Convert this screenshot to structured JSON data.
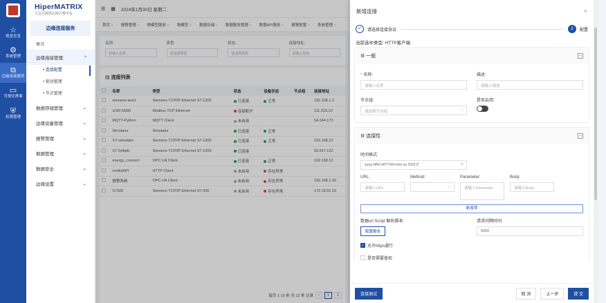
{
  "rail": {
    "items": [
      {
        "label": "视觉总览",
        "icon": "star-icon"
      },
      {
        "label": "系统管理",
        "icon": "gear-icon"
      },
      {
        "label": "边缘连接服务",
        "icon": "connect-icon"
      },
      {
        "label": "可视化界面",
        "icon": "screen-icon"
      },
      {
        "label": "权限管理",
        "icon": "shield-icon"
      }
    ]
  },
  "brand": {
    "name": "HiperMATRIX",
    "sub": "工业互联网边缘计算平台"
  },
  "sidebar": {
    "title": "边缘连接服务",
    "home": "概况",
    "groups": [
      {
        "label": "边缘连接管理",
        "open": true,
        "subs": [
          "连接配置",
          "驱动管理",
          "节点管理"
        ]
      },
      {
        "label": "数据存储管理"
      },
      {
        "label": "边缘设备管理"
      },
      {
        "label": "报警管理"
      },
      {
        "label": "数据管理"
      },
      {
        "label": "数据安全"
      },
      {
        "label": "边缘设置"
      }
    ]
  },
  "topbar": {
    "date": "2024年1月30日 星期二"
  },
  "tabs": [
    "首页",
    "报警管理",
    "物模型服务",
    "物模型",
    "数据存储",
    "数据服务管理",
    "数据API服务",
    "报警配置",
    "系统管理"
  ],
  "filters": [
    {
      "label": "名称:",
      "placeholder": "请输入名称"
    },
    {
      "label": "类型:",
      "placeholder": "请选择类型"
    },
    {
      "label": "状态:",
      "placeholder": "请选择状态"
    },
    {
      "label": "连接地址:",
      "placeholder": "请输入地址"
    }
  ],
  "list": {
    "title": "连接列表",
    "columns": [
      "名称",
      "类型",
      "状态",
      "设备状态",
      "节点组",
      "连接地址"
    ],
    "rows": [
      {
        "name": "siemens-test1",
        "type": "Siemens TCP/IP Ethernet S7-1200",
        "status": "已连接",
        "device": "正常",
        "group": "",
        "addr": "192.168.1.2"
      },
      {
        "name": "USR-N580",
        "type": "Modbus TCP Ethernet",
        "status": "连接断开",
        "device": "",
        "group": "",
        "addr": "111.229.10"
      },
      {
        "name": "MQTT-Python",
        "type": "MQTT Client",
        "status": "未启用",
        "device": "",
        "group": "",
        "addr": "54.244.173"
      },
      {
        "name": "Simulator",
        "type": "Simulator",
        "status": "已连接",
        "device": "正常",
        "group": "",
        "addr": ""
      },
      {
        "name": "S7-simulator",
        "type": "Siemens TCP/IP Ethernet S7-1200",
        "status": "已连接",
        "device": "正常",
        "group": "",
        "addr": "192.168.12"
      },
      {
        "name": "S7-Softplc",
        "type": "Siemens TCP/IP Ethernet S7-1200",
        "status": "已连接",
        "device": "",
        "group": "",
        "addr": "59.247.122"
      },
      {
        "name": "energy_connect",
        "type": "OPC UA Client",
        "status": "已连接",
        "device": "正常",
        "group": "",
        "addr": "192.168.12"
      },
      {
        "name": "restfulAPI",
        "type": "HTTP Client",
        "status": "未启用",
        "device": "存在异常",
        "group": "",
        "addr": ""
      },
      {
        "name": "报警系统",
        "type": "OPC UA Client",
        "status": "未启用",
        "device": "存在异常",
        "group": "",
        "addr": "192.168.1.25"
      },
      {
        "name": "S7300",
        "type": "Siemens TCP/IP Ethernet S7-300",
        "status": "未启用",
        "device": "存在异常",
        "group": "",
        "addr": "172.18.91.10"
      }
    ],
    "pager": {
      "summary": "每页 1-10 条 共 12 条 记录",
      "current": "1",
      "next": "2"
    }
  },
  "drawer": {
    "title": "新增连接",
    "step1": "请选择连接协议",
    "step2": "配置",
    "step1_num": "✓",
    "step2_num": "2",
    "current_type": "当前选中类型: HTTP客户端",
    "general": {
      "title": "一般",
      "name_label": "名称:",
      "name_placeholder": "请输入名称",
      "desc_label": "描述:",
      "desc_placeholder": "请输入描述",
      "group_label": "节点组:",
      "group_placeholder": "请选择节点组",
      "enable_label": "是否启用:"
    },
    "connection": {
      "title": "连接性",
      "time_label": "时间格式:",
      "time_value": "yyyy-MM-dd'T'HH:mm:ss.SSS'Z'",
      "url_label": "URL:",
      "url_placeholder": "请输入URL",
      "method_label": "Method:",
      "param_label": "Parameter:",
      "param_placeholder": "请输入Parameter",
      "body_label": "Body:",
      "body_placeholder": "请输入Body",
      "add_label": "新增项",
      "script_label": "数据url Script 解析脚本:",
      "script_button": "配置脚本",
      "interval_label": "请求间隔时间:",
      "interval_value": "5000",
      "https_label": "允许https通行",
      "auth_label": "是否需要鉴权"
    },
    "footer": {
      "test": "连接测试",
      "cancel": "取 消",
      "prev": "上一步",
      "submit": "提 交"
    }
  },
  "colors": {
    "brand_blue": "#1f4fa3",
    "success": "#22a35a",
    "warning": "#e54646",
    "idle": "#aaaaaa"
  }
}
